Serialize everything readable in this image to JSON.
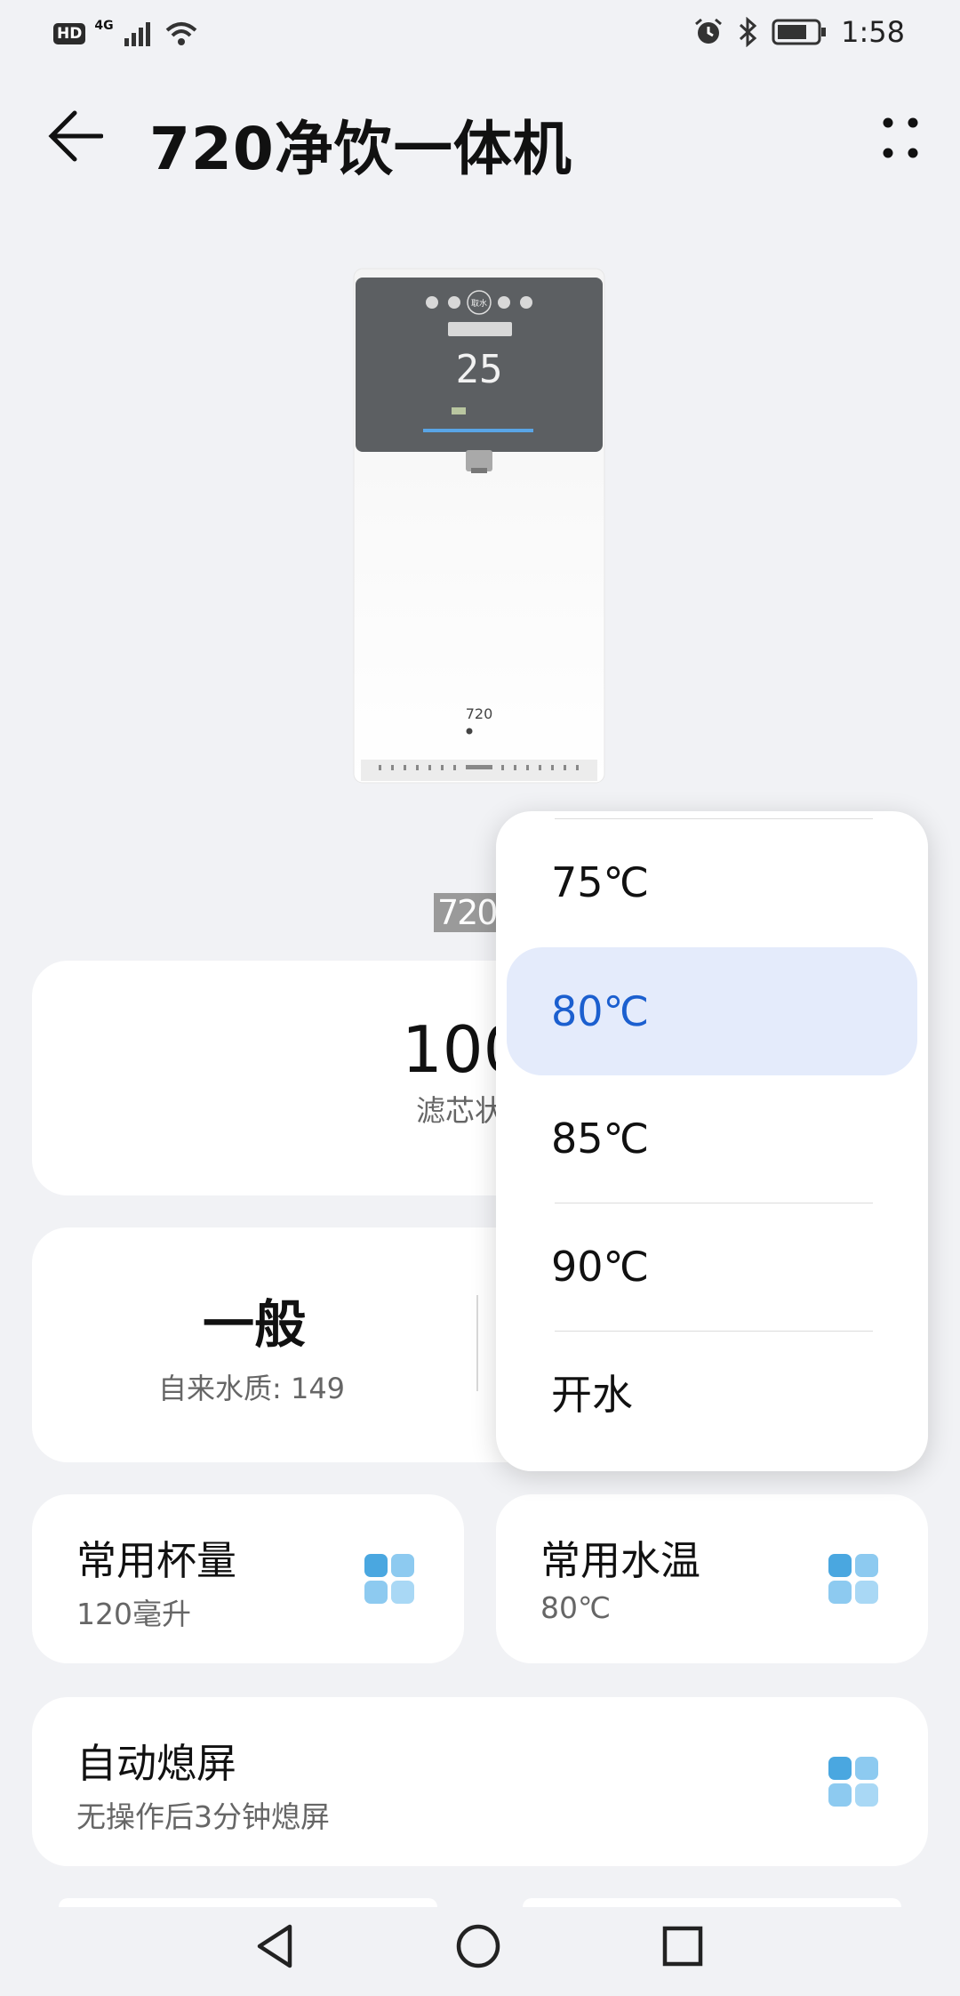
{
  "status_bar": {
    "hd": "HD",
    "network": "4G",
    "time": "1:58",
    "icons": [
      "signal-icon",
      "wifi-icon",
      "alarm-icon",
      "bluetooth-icon",
      "battery-icon"
    ]
  },
  "header": {
    "title": "720净饮一体机"
  },
  "logo_text": "720",
  "filter": {
    "value": "100",
    "label": "滤芯状态"
  },
  "water_quality": {
    "value": "一般",
    "sub": "自来水质: 149"
  },
  "cup_volume": {
    "title": "常用杯量",
    "value": "120毫升"
  },
  "water_temp": {
    "title": "常用水温",
    "value": "80℃"
  },
  "screen_off": {
    "title": "自动熄屏",
    "value": "无操作后3分钟熄屏"
  },
  "temp_dropdown": {
    "options": [
      "75℃",
      "80℃",
      "85℃",
      "90℃",
      "开水"
    ],
    "selected": "80℃"
  },
  "device_display": {
    "temp": "25",
    "label": "取水",
    "model": "720"
  },
  "colors": {
    "accent": "#1b5fcf",
    "selected_bg": "#e4ebfb",
    "icon_blue": "#4aa7e0"
  }
}
